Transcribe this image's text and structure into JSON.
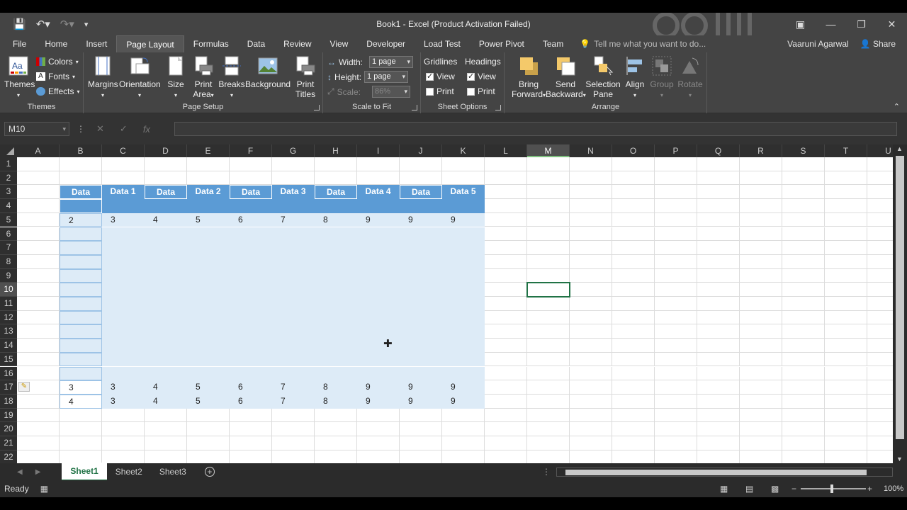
{
  "window": {
    "title": "Book1 - Excel (Product Activation Failed)",
    "controls": [
      "ribbon-display-icon",
      "minimize-icon",
      "restore-icon",
      "close-icon"
    ]
  },
  "menu": {
    "items": [
      "File",
      "Home",
      "Insert",
      "Page Layout",
      "Formulas",
      "Data",
      "Review",
      "View",
      "Developer",
      "Load Test",
      "Power Pivot",
      "Team"
    ],
    "active": "Page Layout",
    "tell_me": "Tell me what you want to do...",
    "user": "Vaaruni Agarwal",
    "share": "Share"
  },
  "ribbon": {
    "themes": {
      "label": "Themes",
      "group": "Themes",
      "colors": "Colors",
      "fonts": "Fonts",
      "effects": "Effects"
    },
    "page_setup": {
      "group": "Page Setup",
      "margins": "Margins",
      "orientation": "Orientation",
      "size": "Size",
      "print_area_1": "Print",
      "print_area_2": "Area",
      "breaks": "Breaks",
      "background": "Background",
      "print_titles_1": "Print",
      "print_titles_2": "Titles"
    },
    "scale": {
      "group": "Scale to Fit",
      "width_label": "Width:",
      "width_value": "1 page",
      "height_label": "Height:",
      "height_value": "1 page",
      "scale_label": "Scale:",
      "scale_value": "86%"
    },
    "sheet_options": {
      "group": "Sheet Options",
      "gridlines": "Gridlines",
      "headings": "Headings",
      "view": "View",
      "print": "Print"
    },
    "arrange": {
      "group": "Arrange",
      "bring_1": "Bring",
      "bring_2": "Forward",
      "send_1": "Send",
      "send_2": "Backward",
      "selection_1": "Selection",
      "selection_2": "Pane",
      "align": "Align",
      "groupbtn": "Group",
      "rotate": "Rotate"
    }
  },
  "formula_bar": {
    "name_box": "M10",
    "fx": "fx",
    "value": ""
  },
  "columns": [
    "A",
    "B",
    "C",
    "D",
    "E",
    "F",
    "G",
    "H",
    "I",
    "J",
    "K",
    "L",
    "M",
    "N",
    "O",
    "P",
    "Q",
    "R",
    "S",
    "T",
    "U"
  ],
  "selected_column": "M",
  "rows": [
    "1",
    "2",
    "3",
    "4",
    "5",
    "6",
    "7",
    "8",
    "9",
    "10",
    "11",
    "12",
    "13",
    "14",
    "15",
    "16",
    "17",
    "18",
    "19",
    "20",
    "21",
    "22"
  ],
  "selected_row": "10",
  "table": {
    "headers": [
      "Data",
      "Data 1",
      "Data",
      "Data 2",
      "Data",
      "Data 3",
      "Data",
      "Data 4",
      "Data",
      "Data 5"
    ],
    "row5": [
      "2",
      "3",
      "4",
      "5",
      "6",
      "7",
      "8",
      "9",
      "9",
      "9"
    ],
    "row17": [
      "3",
      "3",
      "4",
      "5",
      "6",
      "7",
      "8",
      "9",
      "9",
      "9"
    ],
    "row18": [
      "4",
      "3",
      "4",
      "5",
      "6",
      "7",
      "8",
      "9",
      "9",
      "9"
    ]
  },
  "sheets": {
    "tabs": [
      "Sheet1",
      "Sheet2",
      "Sheet3"
    ],
    "active": "Sheet1"
  },
  "status": {
    "text": "Ready",
    "zoom": "100%"
  },
  "colors": {
    "accent": "#217346",
    "header_blue": "#5b9bd5",
    "band_blue": "#ddebf7"
  }
}
